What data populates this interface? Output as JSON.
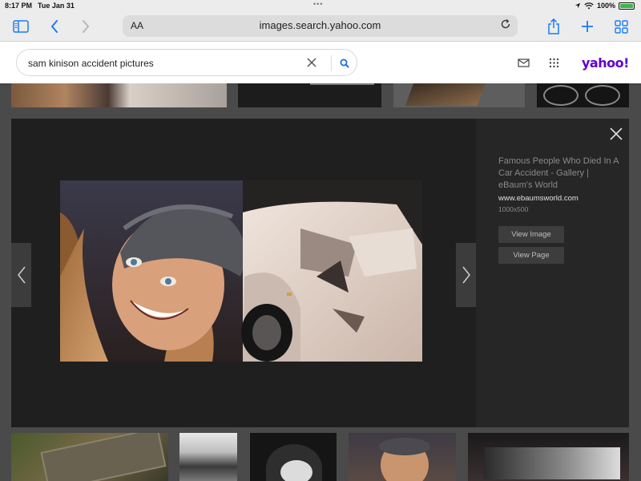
{
  "status": {
    "time": "8:17 PM",
    "date": "Tue Jan 31",
    "battery": "100%",
    "battery_level": 1.0
  },
  "browser": {
    "url_aa": "AA",
    "url": "images.search.yahoo.com"
  },
  "search": {
    "query": "sam kinison accident pictures"
  },
  "brand": {
    "logo": "yahoo!",
    "color": "#6001d2"
  },
  "lightbox": {
    "title": "Famous People Who Died In A Car Accident - Gallery | eBaum's World",
    "domain": "www.ebaumsworld.com",
    "dimensions": "1000x500",
    "view_image_label": "View Image",
    "view_page_label": "View Page"
  },
  "icons": {
    "sidebar": "sidebar-icon",
    "back": "chevron-left-icon",
    "forward": "chevron-right-icon",
    "reload": "reload-icon",
    "share": "share-icon",
    "new_tab": "plus-icon",
    "tabs": "tabs-grid-icon",
    "clear": "close-icon",
    "search": "search-icon",
    "mail": "mail-icon",
    "apps": "apps-grid-icon"
  }
}
